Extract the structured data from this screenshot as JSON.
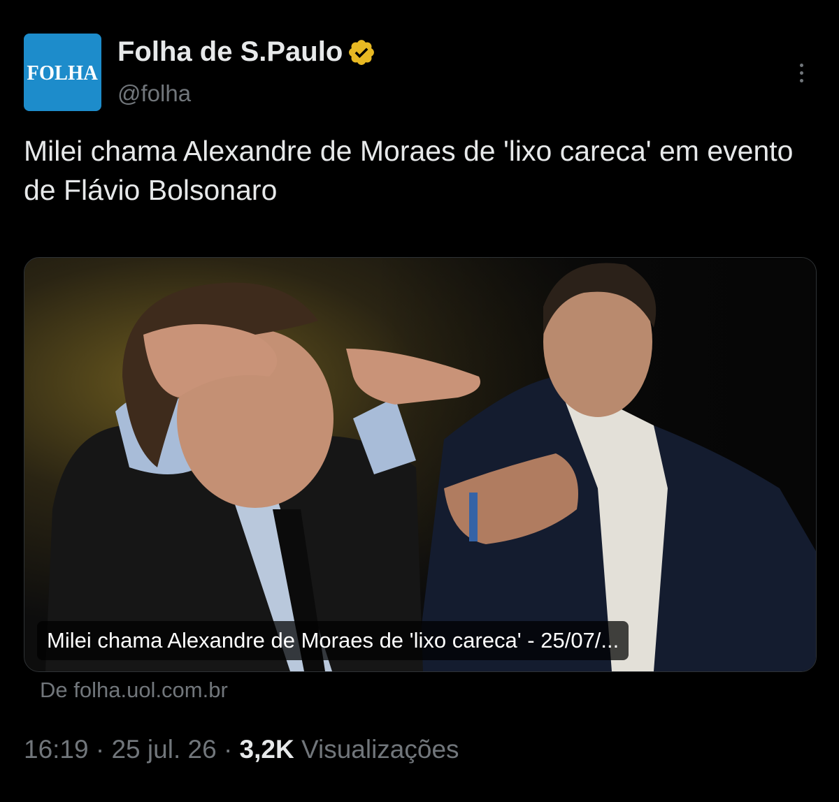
{
  "account": {
    "avatar_text": "FOLHA",
    "display_name": "Folha de S.Paulo",
    "handle": "@folha",
    "verified_icon": "verified-badge-gold-icon",
    "avatar_color": "#1d8ccb",
    "verified_color": "#e8b923"
  },
  "tweet": {
    "text": "Milei chama Alexandre de Moraes de 'lixo careca' em evento de Flávio Bolsonaro"
  },
  "card": {
    "image_icon": "news-photo",
    "title": "Milei chama Alexandre de Moraes de 'lixo careca' - 25/07/...",
    "source": "De folha.uol.com.br"
  },
  "meta": {
    "time": "16:19",
    "separator": "·",
    "date": "25 jul. 26",
    "views_count": "3,2K",
    "views_label": "Visualizações"
  },
  "more_icon": "more-options-icon"
}
